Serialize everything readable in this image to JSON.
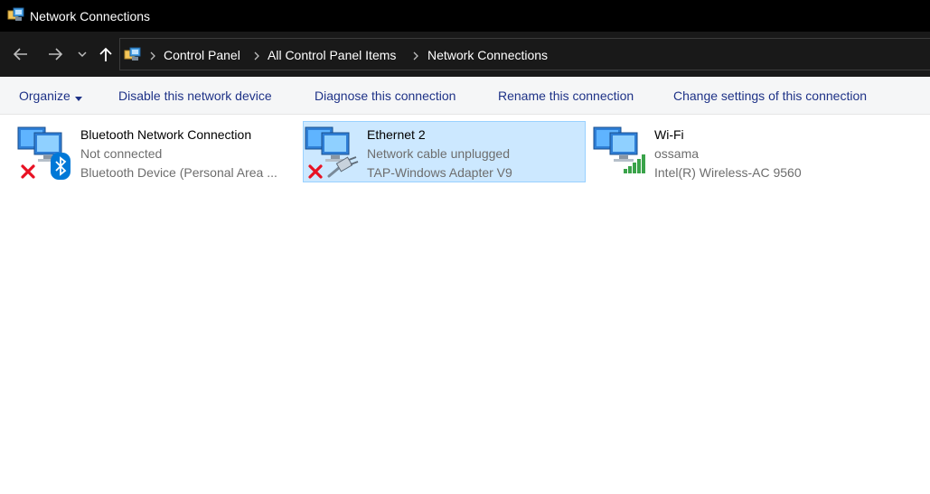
{
  "window": {
    "title": "Network Connections"
  },
  "breadcrumb": [
    "Control Panel",
    "All Control Panel Items",
    "Network Connections"
  ],
  "commands": {
    "organize": "Organize",
    "disable": "Disable this network device",
    "diagnose": "Diagnose this connection",
    "rename": "Rename this connection",
    "change_settings": "Change settings of this connection"
  },
  "connections": [
    {
      "name": "Bluetooth Network Connection",
      "status": "Not connected",
      "device": "Bluetooth Device (Personal Area ...",
      "badge_icon": "bluetooth-icon",
      "error": true,
      "selected": false
    },
    {
      "name": "Ethernet 2",
      "status": "Network cable unplugged",
      "device": "TAP-Windows Adapter V9",
      "badge_icon": "ethernet-cable-icon",
      "error": true,
      "selected": true
    },
    {
      "name": "Wi-Fi",
      "status": "ossama",
      "device": "Intel(R) Wireless-AC 9560",
      "badge_icon": "wifi-signal-icon",
      "error": false,
      "selected": false
    }
  ],
  "colors": {
    "titlebar_bg": "#000000",
    "navbar_bg": "#191919",
    "command_text": "#1e3287",
    "selection_bg": "#cce8ff",
    "selection_border": "#99d1ff",
    "secondary_text": "#6d6d6d",
    "error_red": "#e81123",
    "bluetooth_blue": "#0078d7"
  }
}
